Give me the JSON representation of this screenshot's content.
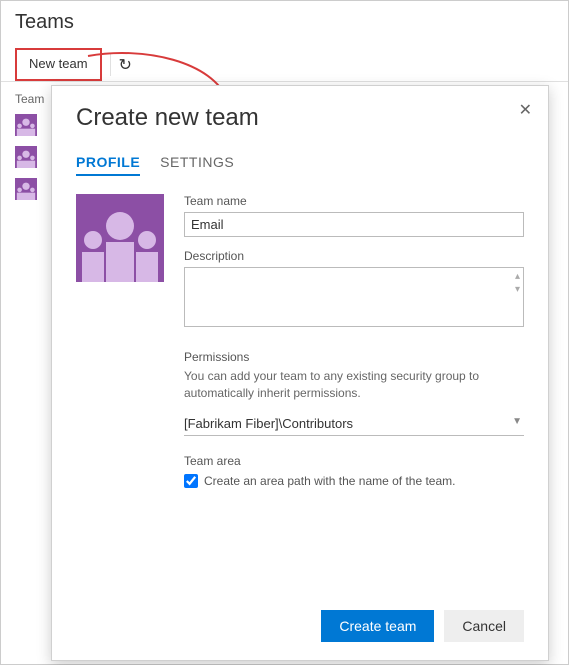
{
  "header": {
    "title": "Teams"
  },
  "toolbar": {
    "new_team_label": "New team",
    "teams_label": "Team"
  },
  "modal": {
    "title": "Create new team",
    "tabs": {
      "profile": "PROFILE",
      "settings": "SETTINGS"
    },
    "fields": {
      "team_name_label": "Team name",
      "team_name_value": "Email",
      "description_label": "Description",
      "permissions_label": "Permissions",
      "permissions_help": "You can add your team to any existing security group to automatically inherit permissions.",
      "permissions_value": "[Fabrikam Fiber]\\Contributors",
      "team_area_label": "Team area",
      "area_checkbox_label": "Create an area path with the name of the team."
    },
    "buttons": {
      "create": "Create team",
      "cancel": "Cancel"
    }
  }
}
